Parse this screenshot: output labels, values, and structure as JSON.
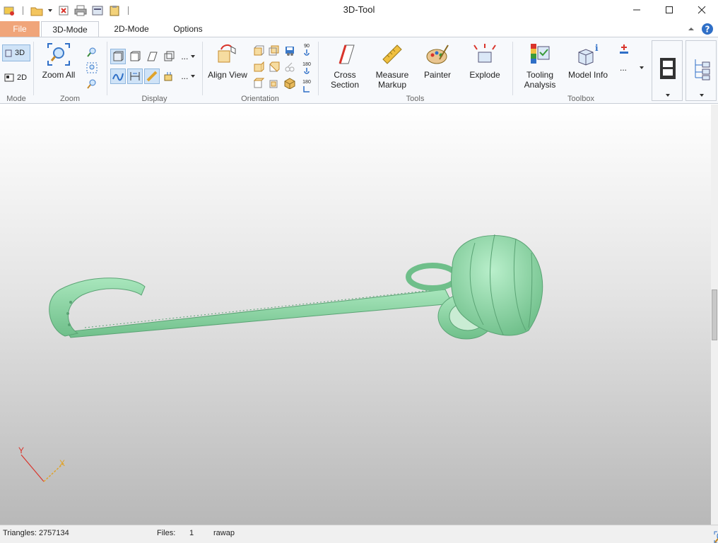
{
  "window": {
    "title": "3D-Tool"
  },
  "tabs": {
    "file": "File",
    "mode3d": "3D-Mode",
    "mode2d": "2D-Mode",
    "options": "Options"
  },
  "ribbon": {
    "mode": {
      "label": "Mode",
      "btn3d": "3D",
      "btn2d": "2D"
    },
    "zoom": {
      "label": "Zoom",
      "zoom_all": "Zoom All"
    },
    "display": {
      "label": "Display",
      "more1": "...",
      "more2": "..."
    },
    "orientation": {
      "label": "Orientation",
      "align_view": "Align View",
      "rot90": "90",
      "rot180a": "180",
      "rot180b": "180"
    },
    "tools": {
      "label": "Tools",
      "cross_section_1": "Cross",
      "cross_section_2": "Section",
      "measure_1": "Measure",
      "measure_2": "Markup",
      "painter": "Painter",
      "explode": "Explode"
    },
    "toolbox": {
      "label": "Toolbox",
      "tooling_1": "Tooling",
      "tooling_2": "Analysis",
      "model_info": "Model Info",
      "more": "..."
    }
  },
  "axes": {
    "y": "Y",
    "x": "X"
  },
  "status": {
    "triangles": "Triangles: 2757134",
    "files_label": "Files:",
    "files_count": "1",
    "file_name": "rawap"
  },
  "colors": {
    "file_tab": "#f0a57a",
    "model": "#8fd4a5",
    "accent": "#1e6fd6"
  }
}
